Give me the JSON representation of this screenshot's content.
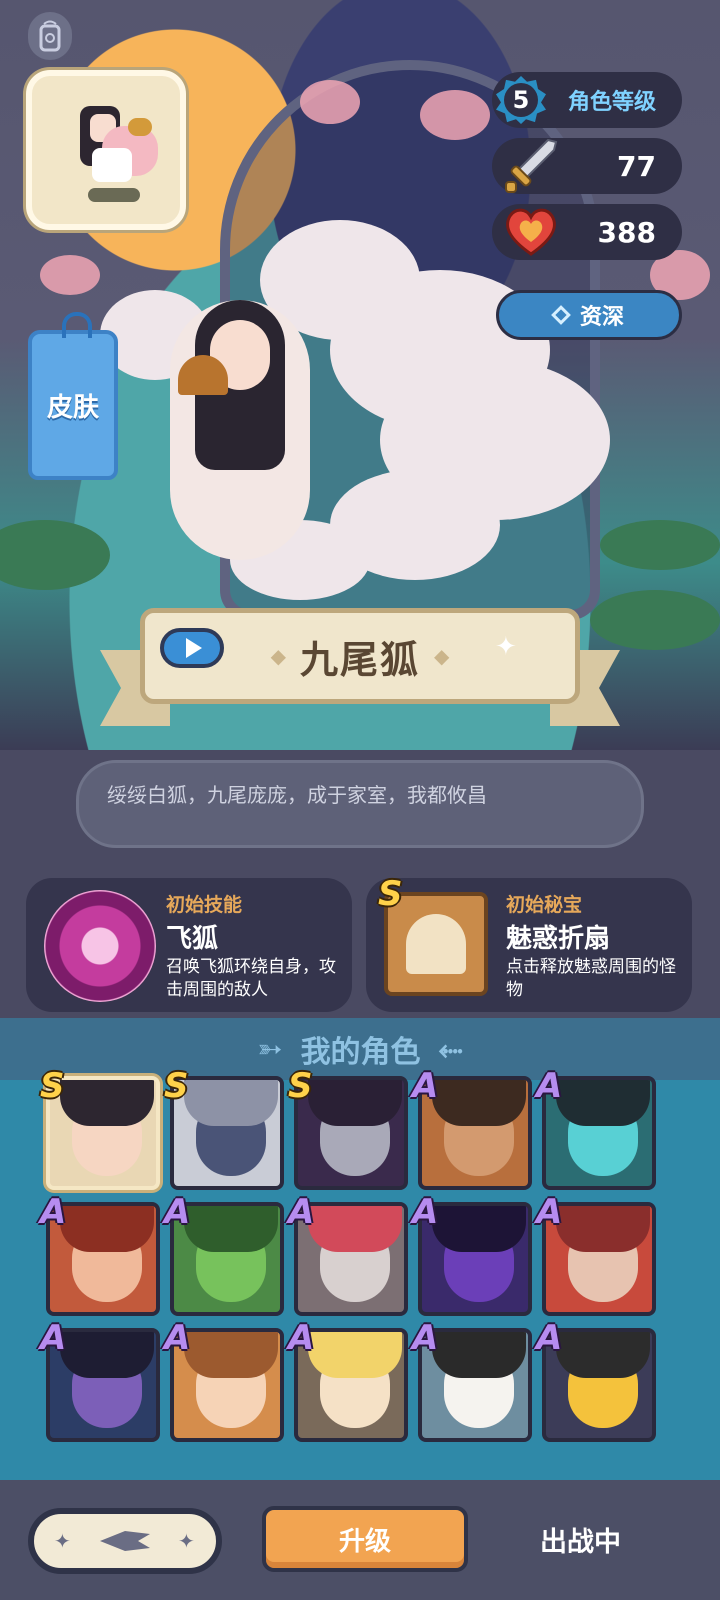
{
  "hero": {
    "level_value": "5",
    "level_label": "角色等级",
    "attack": "77",
    "health": "388",
    "rank_label": "资深",
    "skin_label": "皮肤",
    "name": "九尾狐",
    "description": "绥绥白狐，九尾庞庞，成于家室，我都攸昌"
  },
  "skill": {
    "kind": "初始技能",
    "title": "飞狐",
    "desc": "召唤飞狐环绕自身，攻击周围的敌人"
  },
  "treasure": {
    "grade": "S",
    "kind": "初始秘宝",
    "title": "魅惑折扇",
    "desc": "点击释放魅惑周围的怪物"
  },
  "roster": {
    "title": "我的角色",
    "characters": [
      {
        "grade": "S",
        "bg": "#e9d7b4",
        "skin": "#f6d6c2",
        "hair": "#2d2630",
        "selected": true
      },
      {
        "grade": "S",
        "bg": "#c9ccd6",
        "skin": "#4a5477",
        "hair": "#8d92a6",
        "selected": false
      },
      {
        "grade": "S",
        "bg": "#3a2a4c",
        "skin": "#a9a9b8",
        "hair": "#2a2035",
        "selected": false
      },
      {
        "grade": "A",
        "bg": "#b86f3d",
        "skin": "#d39a6f",
        "hair": "#3d2a20",
        "selected": false
      },
      {
        "grade": "A",
        "bg": "#2b6d73",
        "skin": "#58d0d4",
        "hair": "#1f2d33",
        "selected": false
      },
      {
        "grade": "A",
        "bg": "#c25a3c",
        "skin": "#f0b99a",
        "hair": "#8c2f22",
        "selected": false
      },
      {
        "grade": "A",
        "bg": "#4c8a46",
        "skin": "#77c25c",
        "hair": "#2f5e2c",
        "selected": false
      },
      {
        "grade": "A",
        "bg": "#7c6f73",
        "skin": "#d8d0cf",
        "hair": "#d24a5a",
        "selected": false
      },
      {
        "grade": "A",
        "bg": "#3a2a6b",
        "skin": "#6b3fb8",
        "hair": "#1d1436",
        "selected": false
      },
      {
        "grade": "A",
        "bg": "#c84a3c",
        "skin": "#e7c3b0",
        "hair": "#8a2e2c",
        "selected": false
      },
      {
        "grade": "A",
        "bg": "#2c3d66",
        "skin": "#7c5fb8",
        "hair": "#1e1d33",
        "selected": false
      },
      {
        "grade": "A",
        "bg": "#d58d4c",
        "skin": "#f6d3b6",
        "hair": "#9c5a2f",
        "selected": false
      },
      {
        "grade": "A",
        "bg": "#7a6a5a",
        "skin": "#f5e1c6",
        "hair": "#f2d36a",
        "selected": false
      },
      {
        "grade": "A",
        "bg": "#6e8ea0",
        "skin": "#f5f3ef",
        "hair": "#2a2a2a",
        "selected": false
      },
      {
        "grade": "A",
        "bg": "#3c3c58",
        "skin": "#f4c23c",
        "hair": "#2c2c2c",
        "selected": false
      }
    ]
  },
  "bottom": {
    "upgrade_label": "升级",
    "status_label": "出战中"
  },
  "icons": {
    "system": "phone-link-icon",
    "attack": "sword-icon",
    "health": "heart-icon",
    "rank": "diamond-icon",
    "play": "play-icon",
    "back": "arrow-back-icon"
  }
}
